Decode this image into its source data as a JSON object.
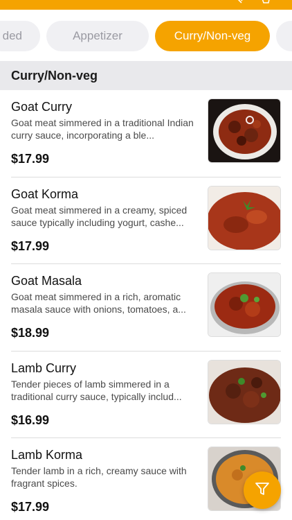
{
  "colors": {
    "accent": "#f5a300",
    "section_bg": "#e9e9ec"
  },
  "top_bar": {
    "icons": [
      "search-icon",
      "cart-icon"
    ]
  },
  "category_tabs": [
    {
      "label": "ded",
      "active": false
    },
    {
      "label": "Appetizer",
      "active": false
    },
    {
      "label": "Curry/Non-veg",
      "active": true
    },
    {
      "label": "",
      "active": false
    }
  ],
  "section_title": "Curry/Non-veg",
  "items": [
    {
      "name": "Goat Curry",
      "description": "Goat meat simmered in a traditional Indian curry sauce, incorporating a ble...",
      "price": "$17.99"
    },
    {
      "name": "Goat Korma",
      "description": "Goat meat simmered in a creamy, spiced sauce typically including yogurt, cashe...",
      "price": "$17.99"
    },
    {
      "name": "Goat Masala",
      "description": "Goat meat simmered in a rich, aromatic masala sauce with onions, tomatoes, a...",
      "price": "$18.99"
    },
    {
      "name": "Lamb Curry",
      "description": "Tender pieces of lamb simmered in a traditional curry sauce, typically includ...",
      "price": "$16.99"
    },
    {
      "name": "Lamb Korma",
      "description": "Tender lamb in a rich, creamy sauce with fragrant spices.",
      "price": "$17.99"
    }
  ],
  "fab": {
    "icon": "filter-icon"
  }
}
